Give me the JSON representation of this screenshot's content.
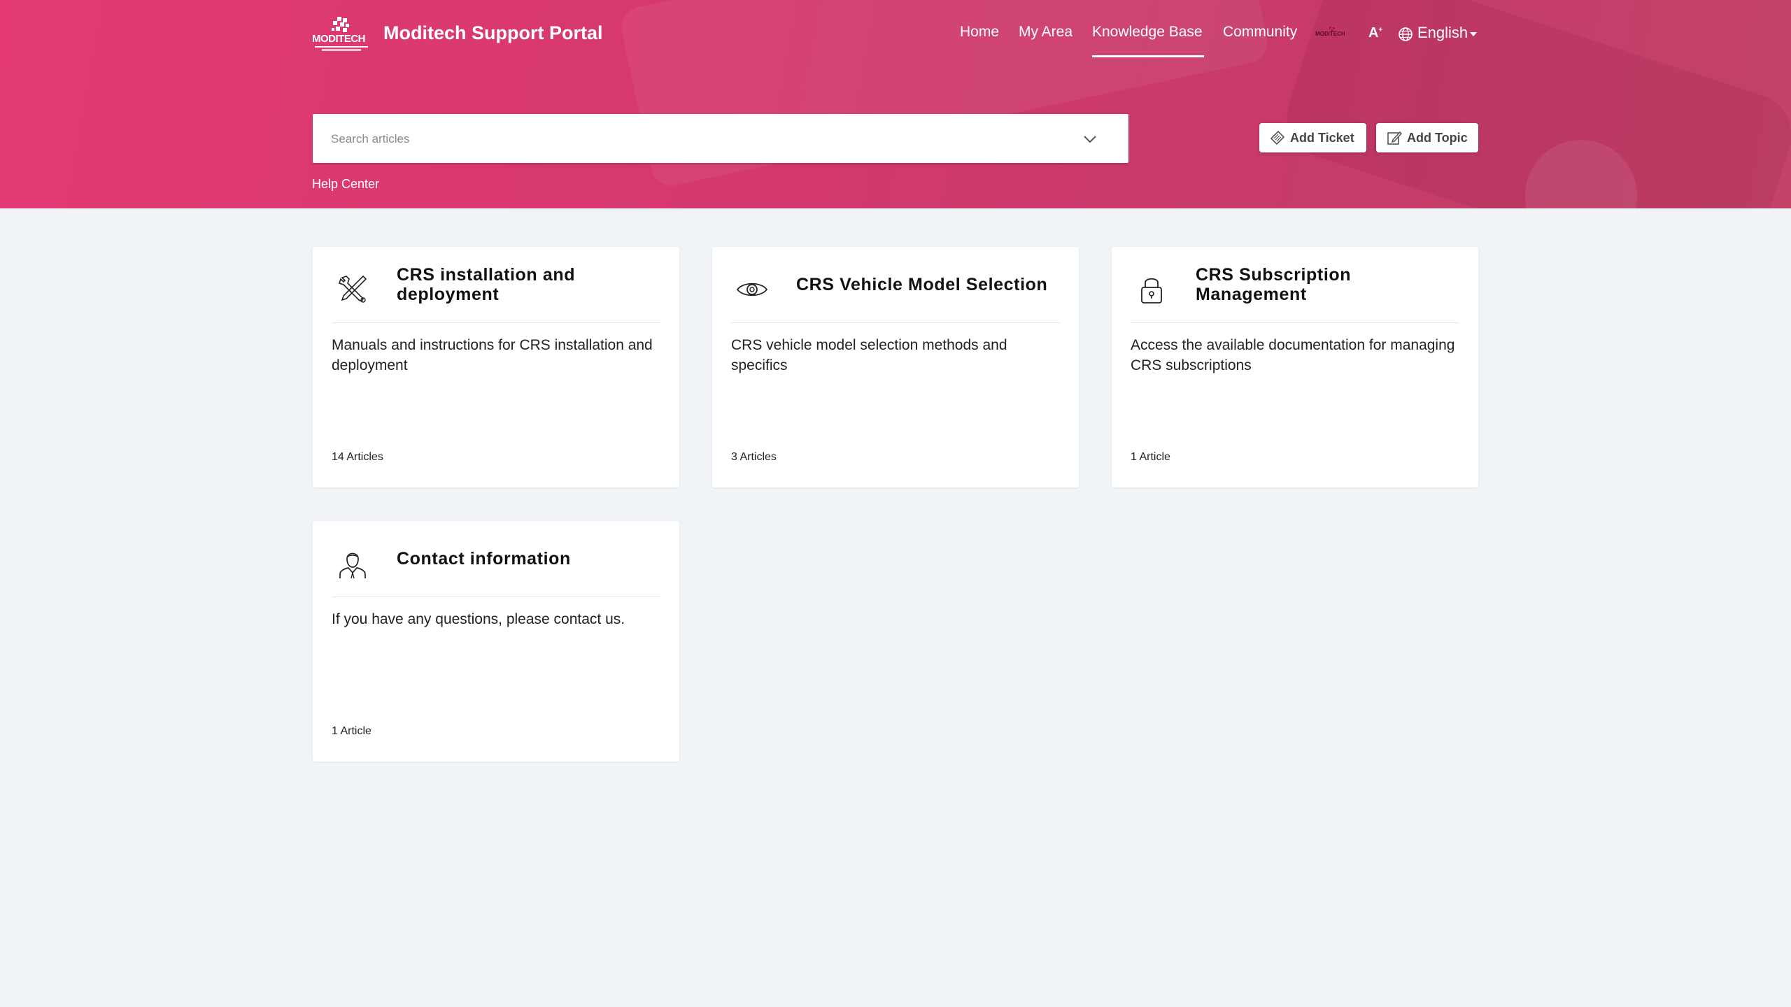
{
  "header": {
    "logo_icon": "moditech-logo-icon",
    "portal_title": "Moditech Support Portal",
    "nav": {
      "home": "Home",
      "my_area": "My Area",
      "knowledge_base": "Knowledge Base",
      "community": "Community",
      "font_size": "A",
      "language": "English"
    }
  },
  "search": {
    "placeholder": "Search articles",
    "value": ""
  },
  "actions": {
    "add_ticket": "Add Ticket",
    "add_topic": "Add Topic"
  },
  "breadcrumb": "Help Center",
  "categories": [
    {
      "icon": "tools-icon",
      "title": "CRS installation and deployment",
      "description": "Manuals and instructions for CRS installation and deployment",
      "count": "14 Articles"
    },
    {
      "icon": "eye-icon",
      "title": "CRS Vehicle Model Selection",
      "description": "CRS vehicle model selection methods and specifics",
      "count": "3 Articles"
    },
    {
      "icon": "lock-icon",
      "title": "CRS Subscription Management",
      "description": "Access the available documentation for managing CRS subscriptions",
      "count": "1 Article"
    },
    {
      "icon": "person-icon",
      "title": "Contact information",
      "description": "If you have any questions, please contact us.",
      "count": "1 Article"
    }
  ],
  "colors": {
    "hero": "#d5386f",
    "background": "#f1f4f7",
    "card": "#ffffff"
  }
}
